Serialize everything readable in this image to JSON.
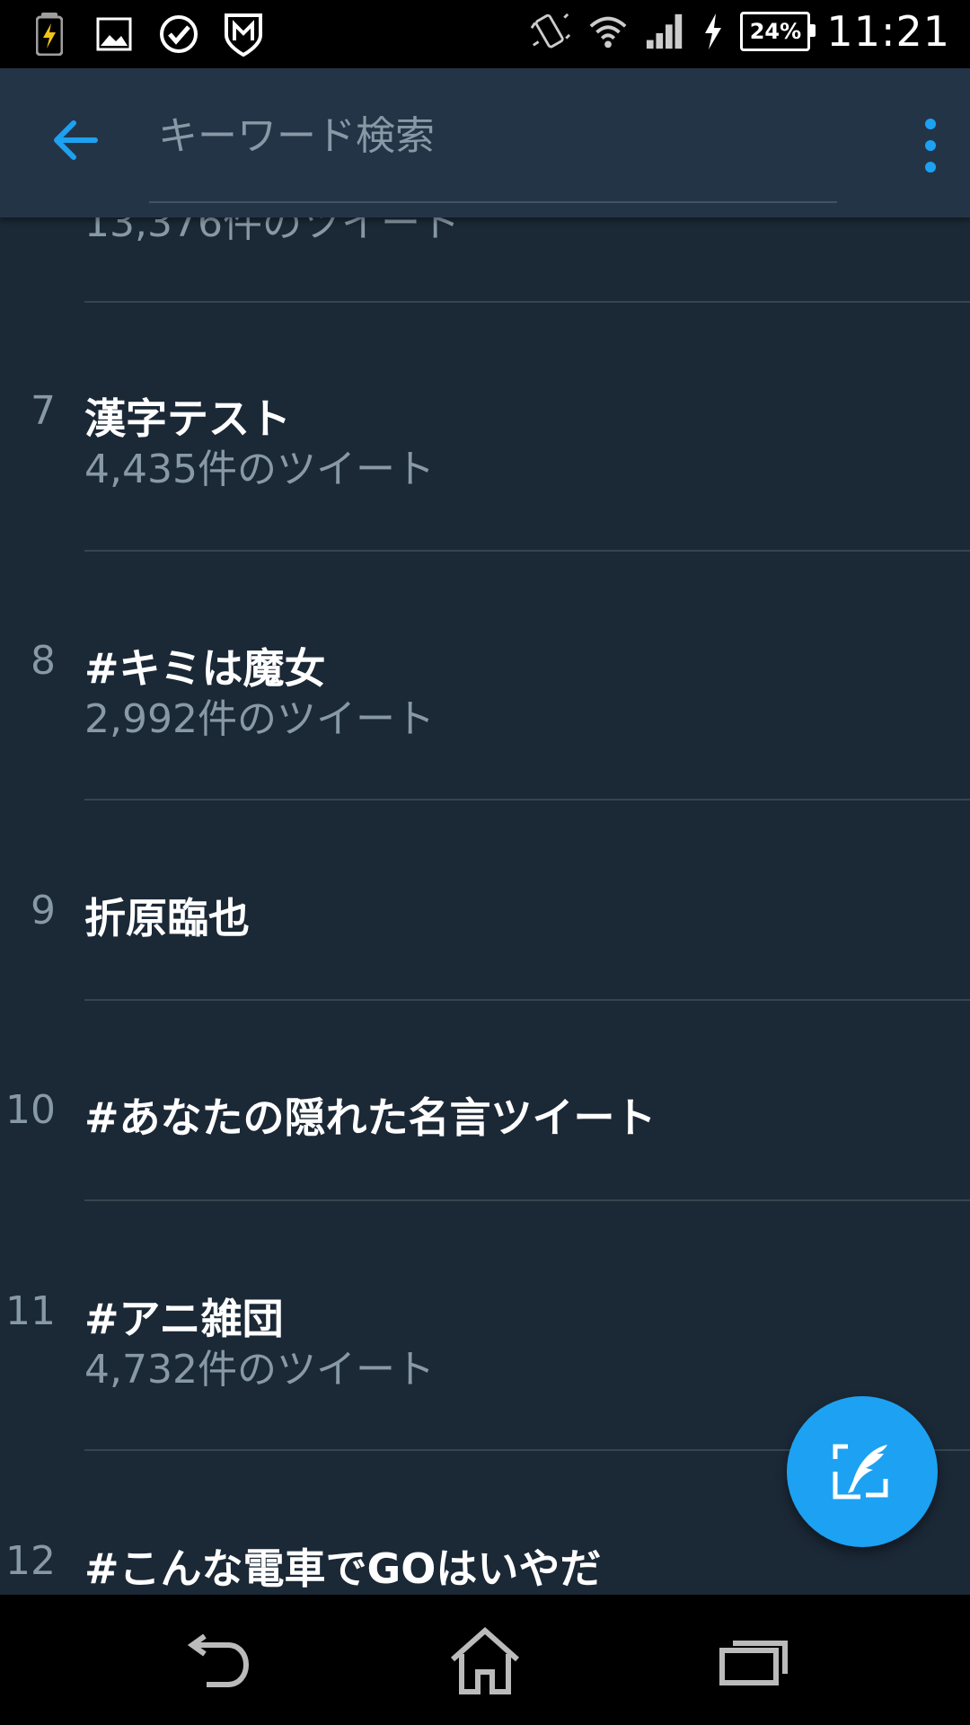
{
  "status_bar": {
    "battery_percent": "24%",
    "time": "11:21",
    "icons": [
      "battery-charging-icon",
      "gallery-icon",
      "check-circle-icon",
      "mcafee-icon",
      "vibrate-icon",
      "wifi-icon",
      "cell-signal-icon",
      "charging-bolt-icon"
    ]
  },
  "toolbar": {
    "search_placeholder": "キーワード検索",
    "back_icon": "arrow-left-icon",
    "more_icon": "more-vert-icon",
    "accent_color": "#1da1f2"
  },
  "partial_row_text": "13,376件のツイート",
  "trends": [
    {
      "rank": "7",
      "title": "漢字テスト",
      "count": "4,435件のツイート"
    },
    {
      "rank": "8",
      "title": "#キミは魔女",
      "count": "2,992件のツイート"
    },
    {
      "rank": "9",
      "title": "折原臨也",
      "count": ""
    },
    {
      "rank": "10",
      "title": "#あなたの隠れた名言ツイート",
      "count": ""
    },
    {
      "rank": "11",
      "title": "#アニ雑団",
      "count": "4,732件のツイート"
    },
    {
      "rank": "12",
      "title": "#こんな電車でGOはいやだ",
      "count": ""
    }
  ],
  "fab": {
    "icon": "compose-tweet-icon"
  },
  "nav_bar": {
    "icons": [
      "back-nav-icon",
      "home-icon",
      "recents-icon"
    ]
  }
}
